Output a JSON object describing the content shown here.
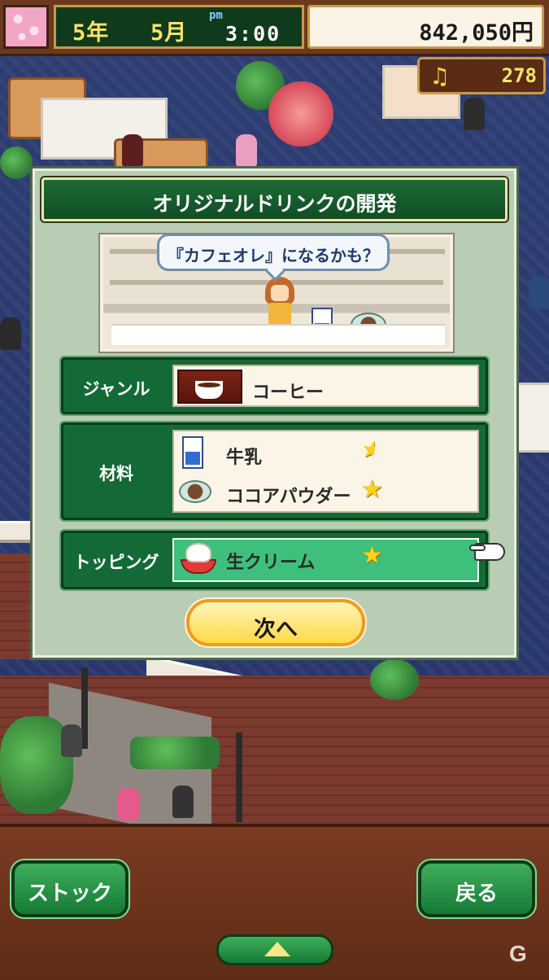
{
  "status": {
    "year": "5年",
    "month": "5月",
    "ampm": "pm",
    "time": "3:00",
    "money": "842,050円",
    "notes": "278",
    "note_icon": "music-note-icon"
  },
  "dialog": {
    "title": "オリジナルドリンクの開発",
    "speech": "『カフェオレ』になるかも？",
    "genre_label": "ジャンル",
    "genre_value": "コーヒー",
    "ingredients_label": "材料",
    "ingredients": [
      {
        "name": "牛乳",
        "icon": "milk-carton-icon",
        "rating": "half-star"
      },
      {
        "name": "ココアパウダー",
        "icon": "cocoa-powder-icon",
        "rating": "star"
      }
    ],
    "topping_label": "トッピング",
    "topping_value": "生クリーム",
    "topping_icon": "whipped-cream-icon",
    "topping_rating": "star",
    "next_button": "次へ"
  },
  "bottom": {
    "stock_button": "ストック",
    "back_button": "戻る"
  },
  "colors": {
    "panel_green": "#146a36",
    "highlight_green": "#3fbf7c",
    "button_yellow": "#ffd94a",
    "gold_text": "#ffe36a"
  }
}
